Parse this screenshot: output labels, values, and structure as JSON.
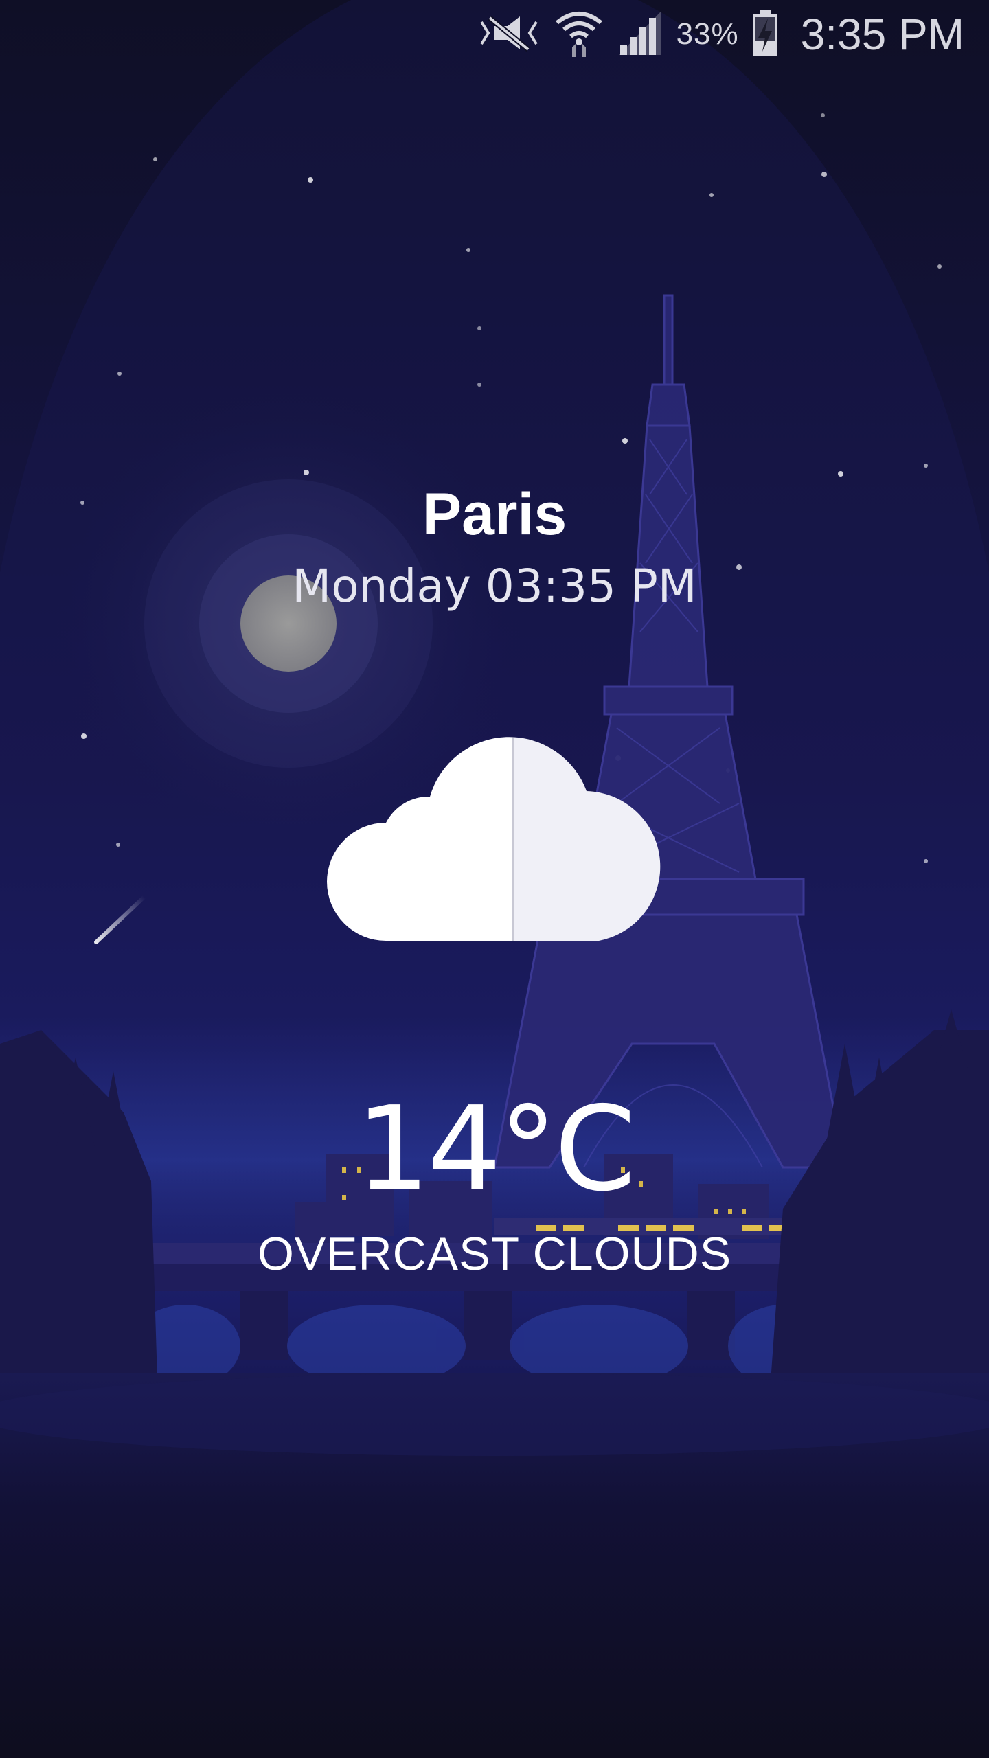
{
  "status_bar": {
    "battery_percent": "33%",
    "time": "3:35 PM",
    "icons": [
      "vibrate-mute-icon",
      "wifi-icon",
      "signal-icon",
      "battery-charging-icon"
    ]
  },
  "weather": {
    "city": "Paris",
    "datetime": "Monday 03:35 PM",
    "temperature": "14°C",
    "condition": "OVERCAST CLOUDS",
    "icon": "cloud-icon"
  },
  "colors": {
    "sky_top": "#0f0f24",
    "sky_mid": "#1a1a5a",
    "ground": "#0e0d1e",
    "text": "#ffffff"
  }
}
